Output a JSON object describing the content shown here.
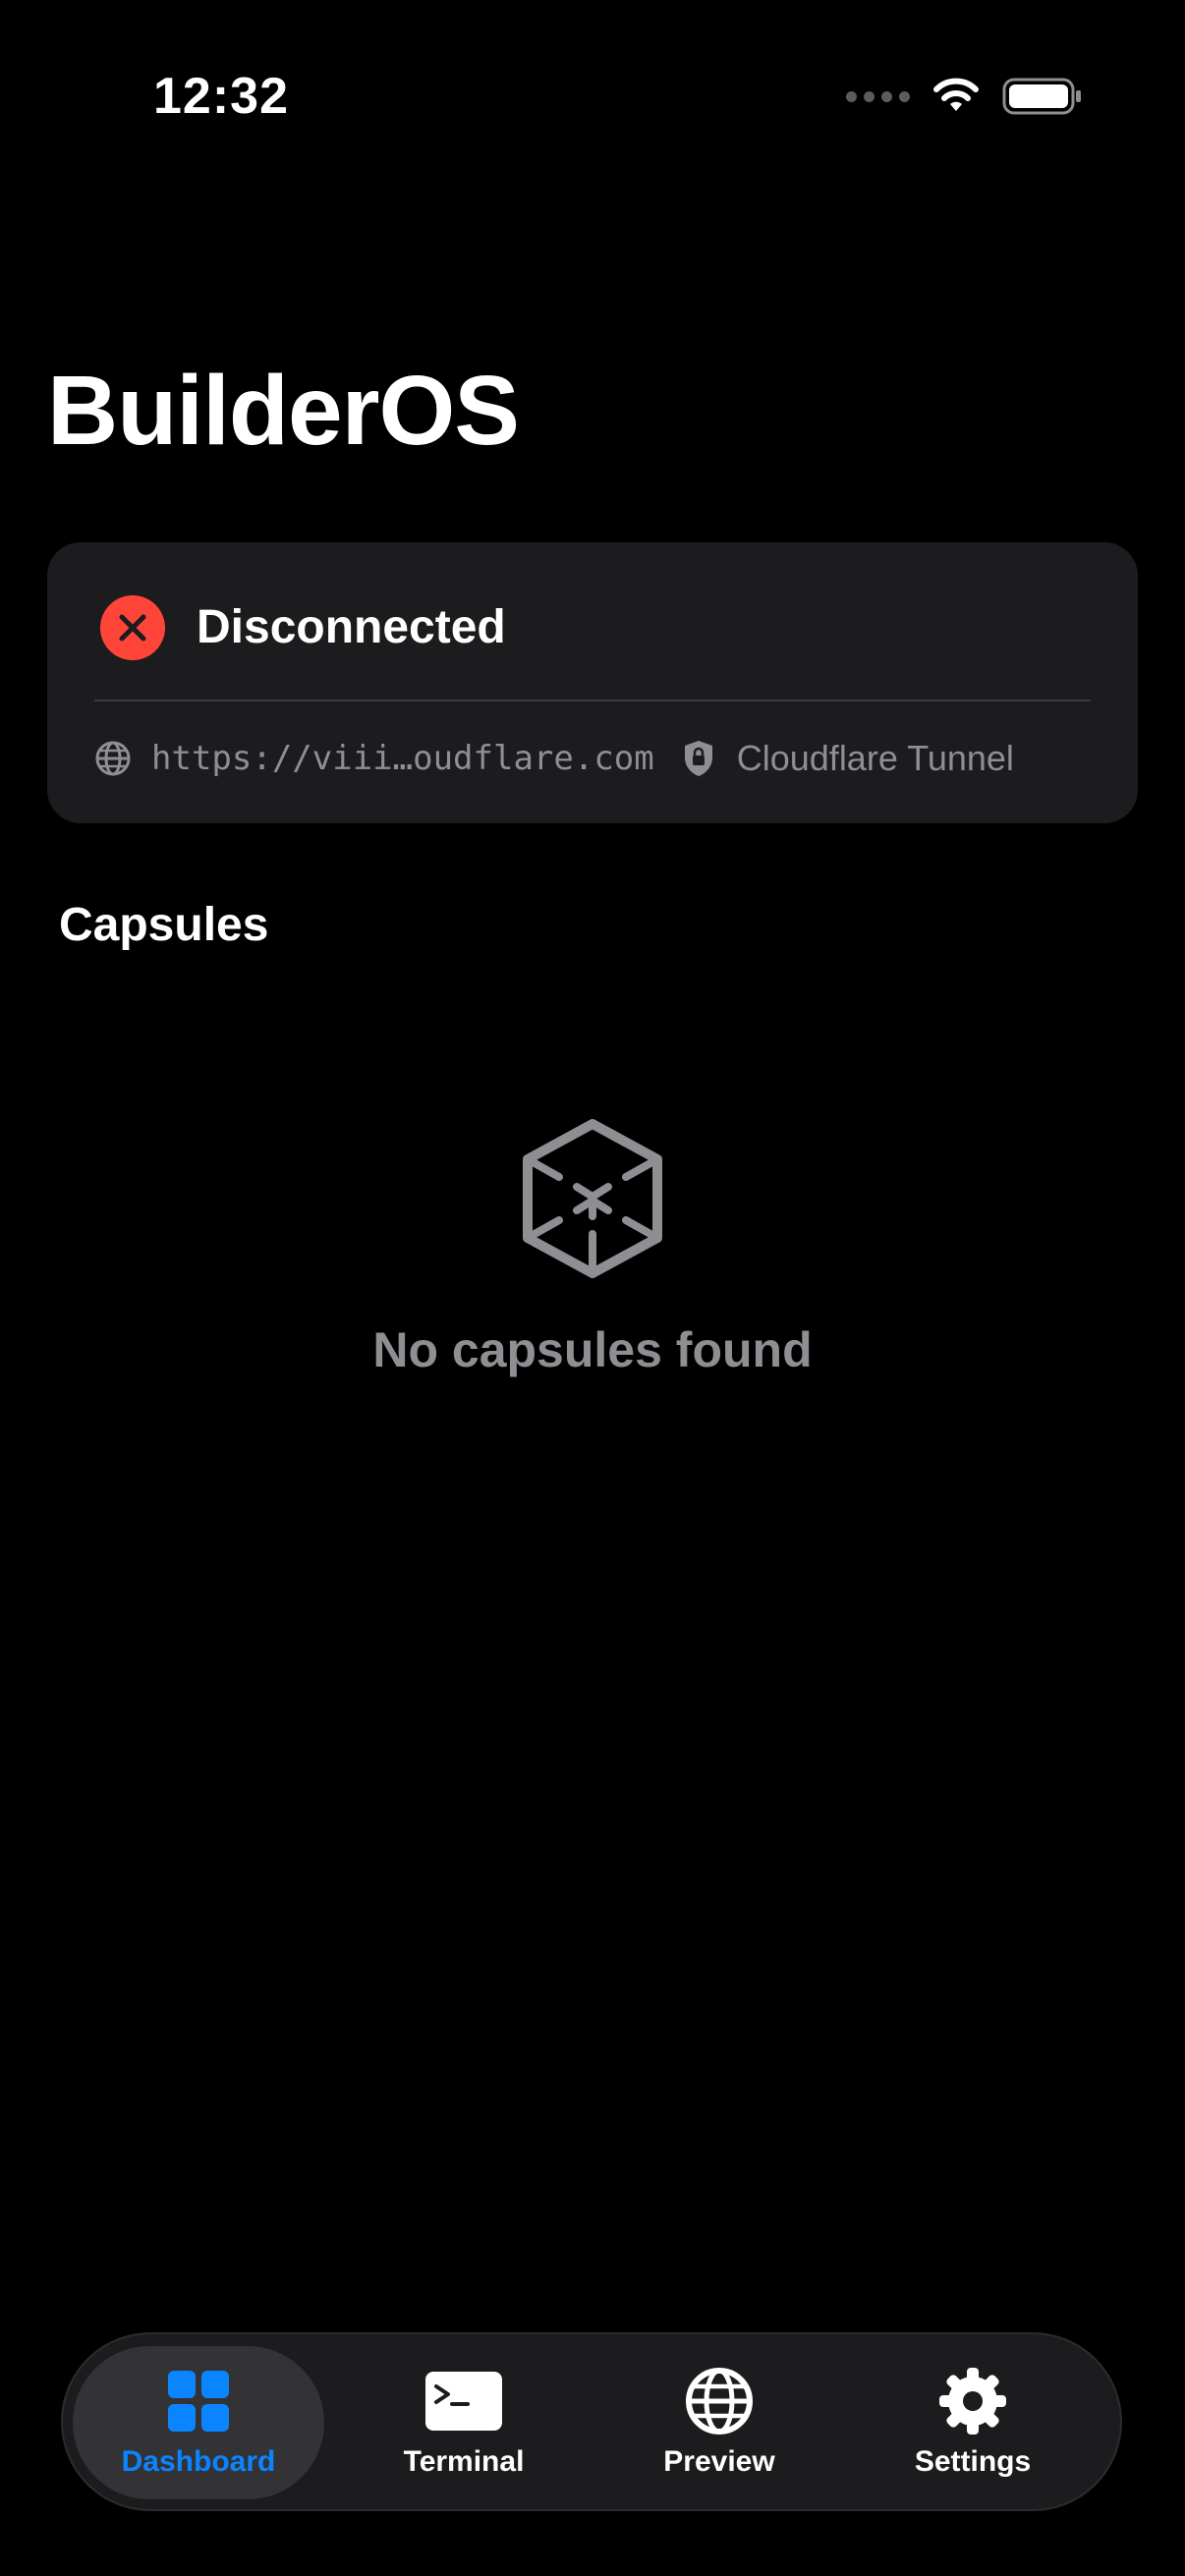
{
  "status_bar": {
    "time": "12:32"
  },
  "app": {
    "title": "BuilderOS"
  },
  "connection": {
    "status_label": "Disconnected",
    "status_color": "#ff453a",
    "url": "https://viii…oudflare.com",
    "tunnel_label": "Cloudflare Tunnel"
  },
  "capsules": {
    "section_title": "Capsules",
    "empty_message": "No capsules found"
  },
  "tabs": [
    {
      "label": "Dashboard",
      "icon": "grid-icon",
      "active": true
    },
    {
      "label": "Terminal",
      "icon": "terminal-icon",
      "active": false
    },
    {
      "label": "Preview",
      "icon": "globe-icon",
      "active": false
    },
    {
      "label": "Settings",
      "icon": "gear-icon",
      "active": false
    }
  ],
  "colors": {
    "background": "#000000",
    "card": "#1c1c1e",
    "accent": "#0a84ff",
    "secondary_text": "#8e8e93"
  }
}
